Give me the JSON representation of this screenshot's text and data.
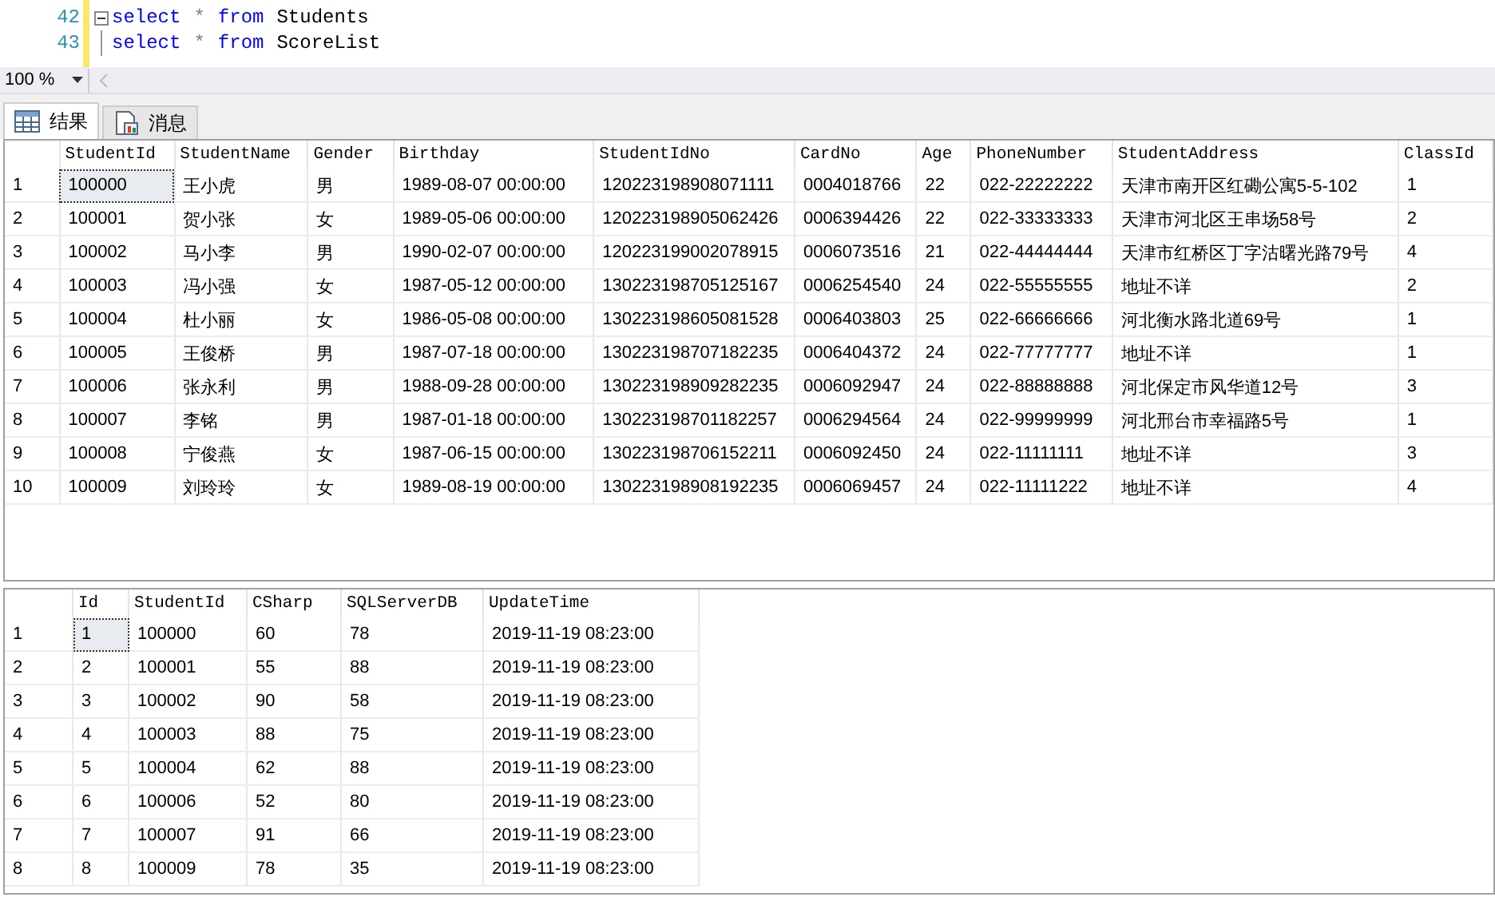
{
  "editor": {
    "lines": [
      {
        "number": "42",
        "collapsible": true,
        "tokens": [
          {
            "kind": "keyword",
            "text": "select"
          },
          {
            "kind": "operator",
            "text": "*"
          },
          {
            "kind": "keyword",
            "text": "from"
          },
          {
            "kind": "plain",
            "text": "Students"
          }
        ]
      },
      {
        "number": "43",
        "collapsible": false,
        "tokens": [
          {
            "kind": "keyword",
            "text": "select"
          },
          {
            "kind": "operator",
            "text": "*"
          },
          {
            "kind": "keyword",
            "text": "from"
          },
          {
            "kind": "plain",
            "text": "ScoreList"
          }
        ]
      }
    ]
  },
  "zoom": {
    "value": "100 %"
  },
  "tabs": [
    {
      "label": "结果",
      "kind": "grid",
      "selected": true
    },
    {
      "label": "消息",
      "kind": "messages",
      "selected": false
    }
  ],
  "grids": [
    {
      "columns": [
        "StudentId",
        "StudentName",
        "Gender",
        "Birthday",
        "StudentIdNo",
        "CardNo",
        "Age",
        "PhoneNumber",
        "StudentAddress",
        "ClassId"
      ],
      "rows": [
        {
          "number": "1",
          "focused": true,
          "cells": [
            "100000",
            "王小虎",
            "男",
            "1989-08-07 00:00:00",
            "120223198908071111",
            "0004018766",
            "22",
            "022-22222222",
            "天津市南开区红磡公寓5-5-102",
            "1"
          ]
        },
        {
          "number": "2",
          "focused": false,
          "cells": [
            "100001",
            "贺小张",
            "女",
            "1989-05-06 00:00:00",
            "120223198905062426",
            "0006394426",
            "22",
            "022-33333333",
            "天津市河北区王串场58号",
            "2"
          ]
        },
        {
          "number": "3",
          "focused": false,
          "cells": [
            "100002",
            "马小李",
            "男",
            "1990-02-07 00:00:00",
            "120223199002078915",
            "0006073516",
            "21",
            "022-44444444",
            "天津市红桥区丁字沽曙光路79号",
            "4"
          ]
        },
        {
          "number": "4",
          "focused": false,
          "cells": [
            "100003",
            "冯小强",
            "女",
            "1987-05-12 00:00:00",
            "130223198705125167",
            "0006254540",
            "24",
            "022-55555555",
            "地址不详",
            "2"
          ]
        },
        {
          "number": "5",
          "focused": false,
          "cells": [
            "100004",
            "杜小丽",
            "女",
            "1986-05-08 00:00:00",
            "130223198605081528",
            "0006403803",
            "25",
            "022-66666666",
            "河北衡水路北道69号",
            "1"
          ]
        },
        {
          "number": "6",
          "focused": false,
          "cells": [
            "100005",
            "王俊桥",
            "男",
            "1987-07-18 00:00:00",
            "130223198707182235",
            "0006404372",
            "24",
            "022-77777777",
            "地址不详",
            "1"
          ]
        },
        {
          "number": "7",
          "focused": false,
          "cells": [
            "100006",
            "张永利",
            "男",
            "1988-09-28 00:00:00",
            "130223198909282235",
            "0006092947",
            "24",
            "022-88888888",
            "河北保定市风华道12号",
            "3"
          ]
        },
        {
          "number": "8",
          "focused": false,
          "cells": [
            "100007",
            "李铭",
            "男",
            "1987-01-18 00:00:00",
            "130223198701182257",
            "0006294564",
            "24",
            "022-99999999",
            "河北邢台市幸福路5号",
            "1"
          ]
        },
        {
          "number": "9",
          "focused": false,
          "cells": [
            "100008",
            "宁俊燕",
            "女",
            "1987-06-15 00:00:00",
            "130223198706152211",
            "0006092450",
            "24",
            "022-11111111",
            "地址不详",
            "3"
          ]
        },
        {
          "number": "10",
          "focused": false,
          "cells": [
            "100009",
            "刘玲玲",
            "女",
            "1989-08-19 00:00:00",
            "130223198908192235",
            "0006069457",
            "24",
            "022-11111222",
            "地址不详",
            "4"
          ]
        }
      ]
    },
    {
      "columns": [
        "Id",
        "StudentId",
        "CSharp",
        "SQLServerDB",
        "UpdateTime"
      ],
      "rows": [
        {
          "number": "1",
          "focused": true,
          "cells": [
            "1",
            "100000",
            "60",
            "78",
            "2019-11-19 08:23:00"
          ]
        },
        {
          "number": "2",
          "focused": false,
          "cells": [
            "2",
            "100001",
            "55",
            "88",
            "2019-11-19 08:23:00"
          ]
        },
        {
          "number": "3",
          "focused": false,
          "cells": [
            "3",
            "100002",
            "90",
            "58",
            "2019-11-19 08:23:00"
          ]
        },
        {
          "number": "4",
          "focused": false,
          "cells": [
            "4",
            "100003",
            "88",
            "75",
            "2019-11-19 08:23:00"
          ]
        },
        {
          "number": "5",
          "focused": false,
          "cells": [
            "5",
            "100004",
            "62",
            "88",
            "2019-11-19 08:23:00"
          ]
        },
        {
          "number": "6",
          "focused": false,
          "cells": [
            "6",
            "100006",
            "52",
            "80",
            "2019-11-19 08:23:00"
          ]
        },
        {
          "number": "7",
          "focused": false,
          "cells": [
            "7",
            "100007",
            "91",
            "66",
            "2019-11-19 08:23:00"
          ]
        },
        {
          "number": "8",
          "focused": false,
          "cells": [
            "8",
            "100009",
            "78",
            "35",
            "2019-11-19 08:23:00"
          ]
        }
      ]
    }
  ]
}
